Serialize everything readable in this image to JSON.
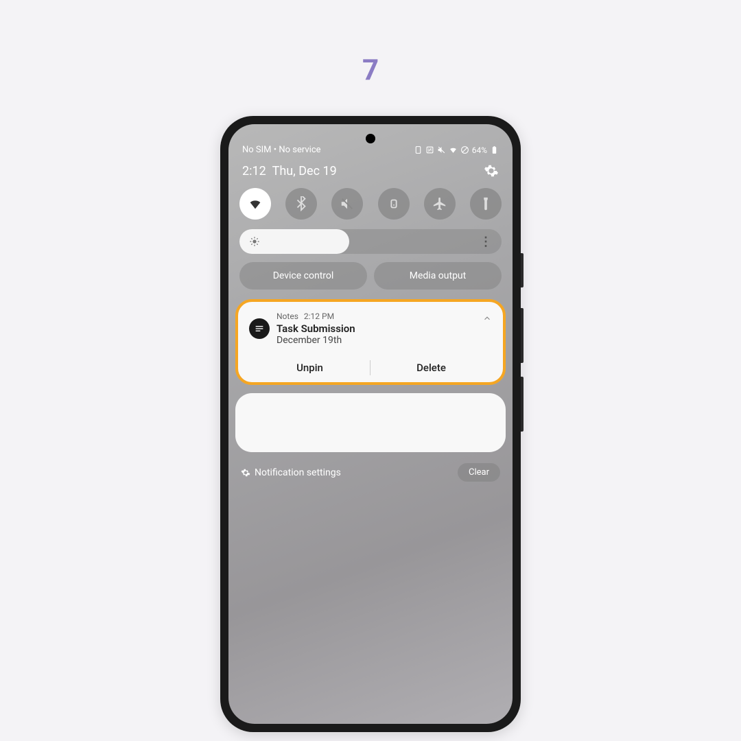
{
  "step": "7",
  "status_bar": {
    "left": "No SIM • No service",
    "battery": "64%"
  },
  "clock": {
    "time": "2:12",
    "date": "Thu, Dec 19"
  },
  "pills": {
    "device_control": "Device control",
    "media_output": "Media output"
  },
  "notification": {
    "app_name": "Notes",
    "time": "2:12 PM",
    "title": "Task Submission",
    "subtitle": "December 19th",
    "action_unpin": "Unpin",
    "action_delete": "Delete"
  },
  "footer": {
    "settings": "Notification settings",
    "clear": "Clear"
  }
}
